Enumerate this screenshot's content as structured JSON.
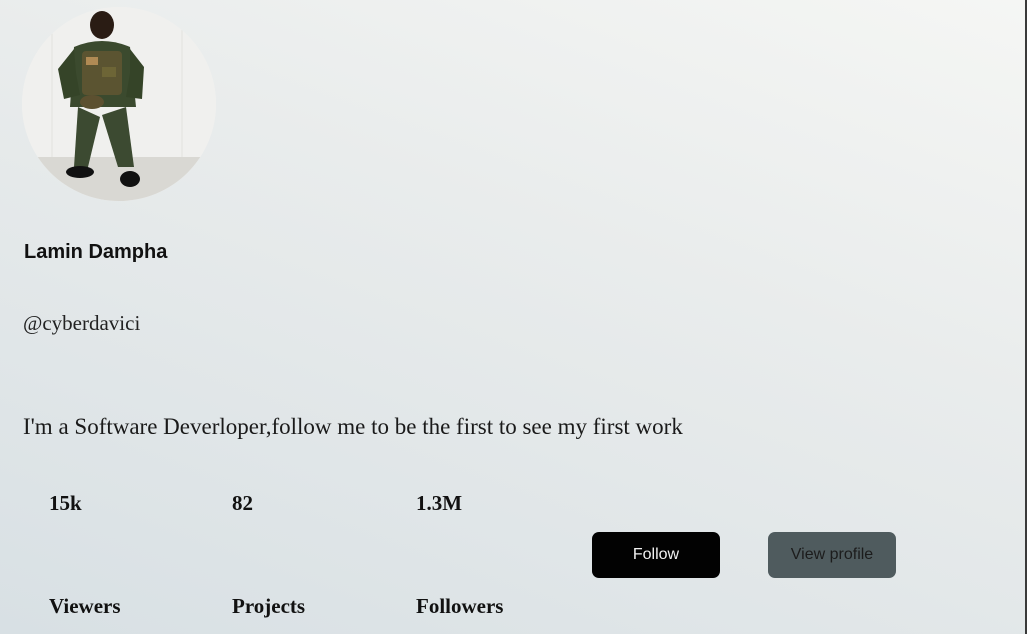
{
  "profile": {
    "name": "Lamin Dampha",
    "handle": "@cyberdavici",
    "bio": "I'm a Software Deverloper,follow me to be the first to see my first work",
    "avatar_icon": "person-photo"
  },
  "stats": [
    {
      "value": "15k",
      "label": "Viewers"
    },
    {
      "value": "82",
      "label": "Projects"
    },
    {
      "value": "1.3M",
      "label": "Followers"
    }
  ],
  "actions": {
    "follow_label": "Follow",
    "view_profile_label": "View profile"
  },
  "colors": {
    "follow_bg": "#020202",
    "view_profile_bg": "#4f5b5e"
  }
}
